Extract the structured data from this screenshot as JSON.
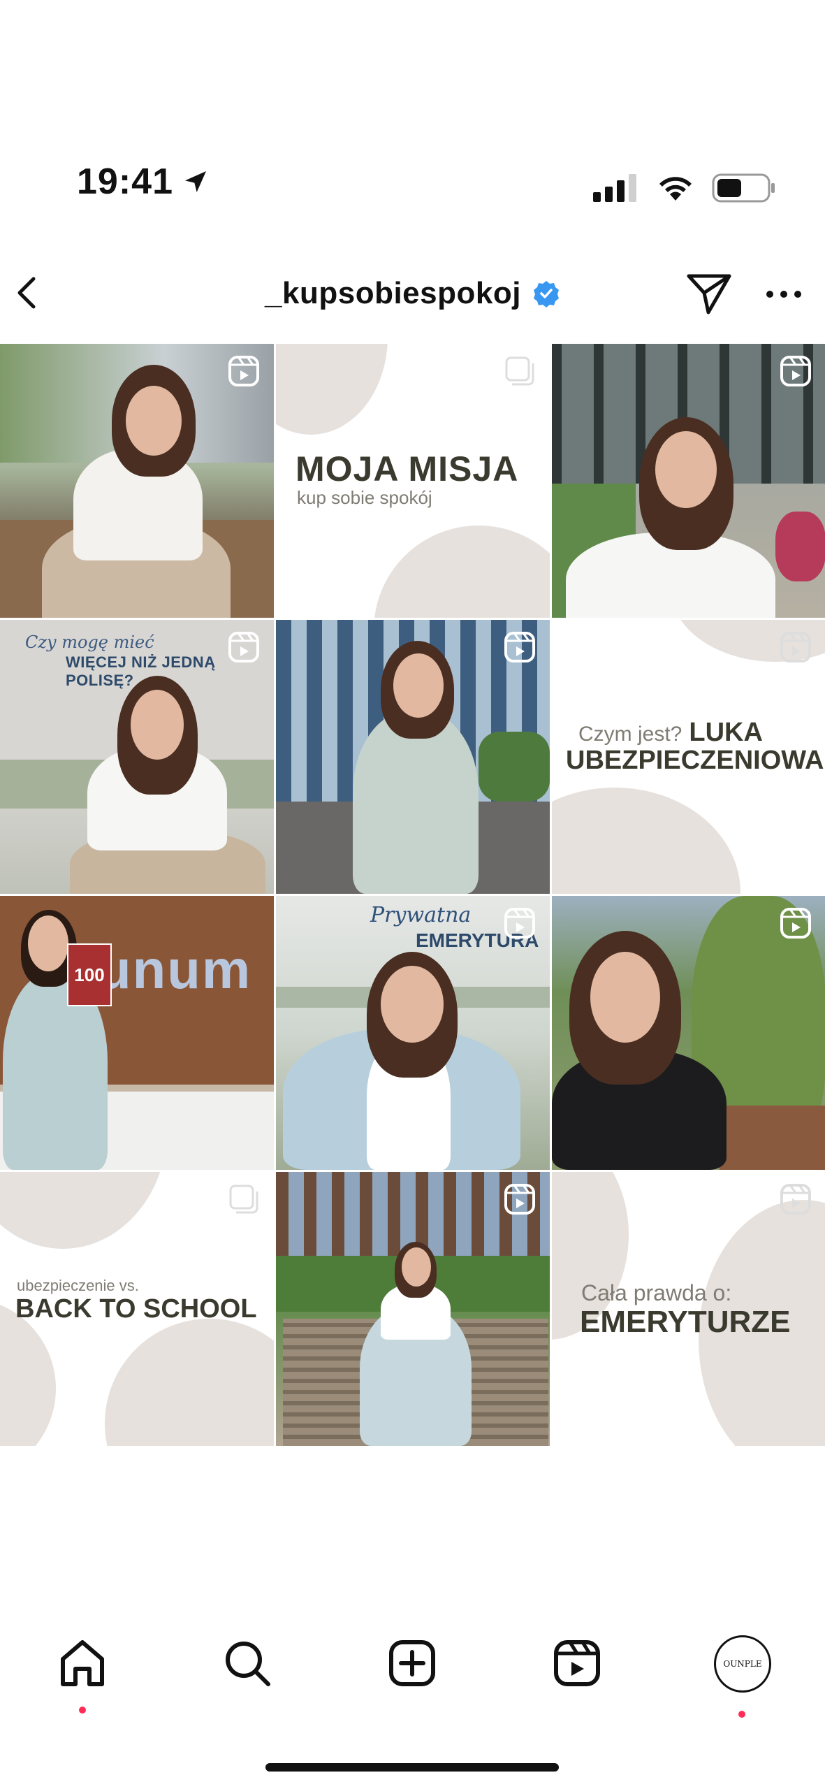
{
  "status_bar": {
    "time": "19:41"
  },
  "header": {
    "username": "_kupsobiespokoj"
  },
  "posts": [
    {
      "type": "reel"
    },
    {
      "type": "carousel",
      "title": "MOJA MISJA",
      "subtitle": "kup sobie spokój"
    },
    {
      "type": "reel"
    },
    {
      "type": "reel",
      "script": "Czy mogę mieć",
      "overlay": "WIĘCEJ NIŻ JEDNĄ POLISĘ?"
    },
    {
      "type": "reel"
    },
    {
      "type": "reel",
      "small": "Czym jest?",
      "title_1": "LUKA",
      "title_2": "UBEZPIECZENIOWA"
    },
    {
      "type": "reel",
      "sign": "unum",
      "magazine": "100"
    },
    {
      "type": "reel",
      "script": "Prywatna",
      "overlay": "EMERYTURA"
    },
    {
      "type": "reel"
    },
    {
      "type": "carousel",
      "small": "ubezpieczenie vs.",
      "title": "BACK TO SCHOOL"
    },
    {
      "type": "reel"
    },
    {
      "type": "reel",
      "small": "Cała prawda o:",
      "title": "EMERYTURZE"
    }
  ],
  "tab_bar": {
    "profile_avatar_text": "OUNPLE"
  }
}
